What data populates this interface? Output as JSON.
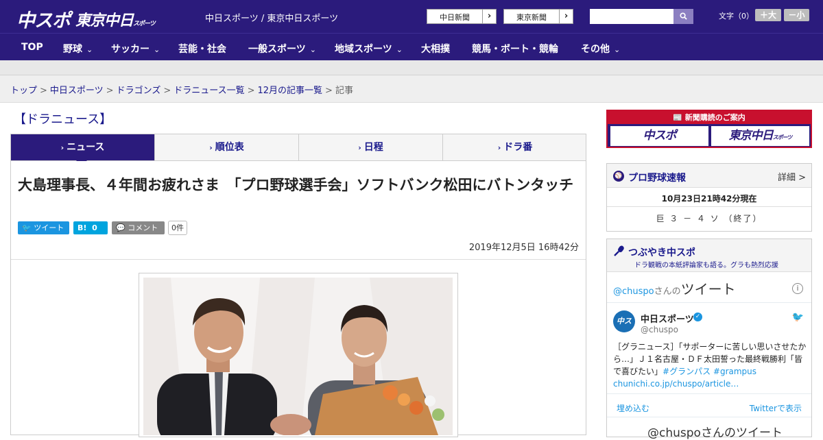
{
  "header": {
    "logo_chuspo": "中スポ",
    "logo_tokyo": "東京中日",
    "logo_tokyo_small": "スポーツ",
    "tagline": "中日スポーツ / 東京中日スポーツ",
    "paper_links": [
      {
        "label": "中日新聞",
        "arrow": "›"
      },
      {
        "label": "東京新聞",
        "arrow": "›"
      }
    ],
    "search": {
      "placeholder": "",
      "button_icon": "search-icon"
    },
    "font_size": {
      "label": "文字（0）",
      "bigger": "＋大",
      "smaller": "－小"
    }
  },
  "nav": {
    "items": [
      {
        "label": "TOP",
        "has_menu": false
      },
      {
        "label": "野球",
        "has_menu": true
      },
      {
        "label": "サッカー",
        "has_menu": true
      },
      {
        "label": "芸能・社会",
        "has_menu": false
      },
      {
        "label": "一般スポーツ",
        "has_menu": true
      },
      {
        "label": "地域スポーツ",
        "has_menu": true
      },
      {
        "label": "大相撲",
        "has_menu": false
      },
      {
        "label": "競馬・ボート・競輪",
        "has_menu": false
      },
      {
        "label": "その他",
        "has_menu": true
      }
    ],
    "chevron": "⌄"
  },
  "breadcrumb": {
    "items": [
      "トップ",
      "中日スポーツ",
      "ドラゴンズ",
      "ドラニュース一覧",
      "12月の記事一覧"
    ],
    "current": "記事",
    "separator": ">"
  },
  "section": {
    "title": "【ドラニュース】"
  },
  "tabs": [
    {
      "label": "ニュース",
      "active": true
    },
    {
      "label": "順位表",
      "active": false
    },
    {
      "label": "日程",
      "active": false
    },
    {
      "label": "ドラ番",
      "active": false
    }
  ],
  "article": {
    "headline": "大島理事長、４年間お疲れさま　「プロ野球選手会」ソフトバンク松田にバトンタッチ",
    "share": {
      "tweet": "ツイート",
      "hatena": "B!",
      "hatena_count": "0",
      "comment": "コメント",
      "comment_count": "0件"
    },
    "date": "2019年12月5日 16時42分"
  },
  "sidebar": {
    "ad": {
      "title": "新聞購読のご案内",
      "button1": "中スポ",
      "button2": "東京中日",
      "button2_small": "スポーツ"
    },
    "score": {
      "title": "プロ野球速報",
      "more": "詳細 >",
      "time": "10月23日21時42分現在",
      "result": "巨 ３ － ４ ソ （終了）"
    },
    "tweets": {
      "title": "つぶやき中スポ",
      "subtitle": "ドラ観戦の本紙評論家も語る。グラも熱烈応援",
      "embed_handle": "@chuspo",
      "embed_suffix": "さんの",
      "embed_word": "ツイート",
      "info": "i",
      "avatar_text": "中スポ",
      "name": "中日スポーツ",
      "handle": "@chuspo",
      "tweet_text": "［グラニュース］「サポーターに苦しい思いさせたから…」Ｊ１名古屋・ＤＦ太田誓った最終戦勝利「皆で喜びたい」",
      "tag1": "#グランパス",
      "tag2": "#grampus",
      "link": "chunichi.co.jp/chuspo/article…",
      "embed_link": "埋め込む",
      "view_link": "Twitterで表示",
      "footer": "@chuspoさんのツイート"
    }
  }
}
